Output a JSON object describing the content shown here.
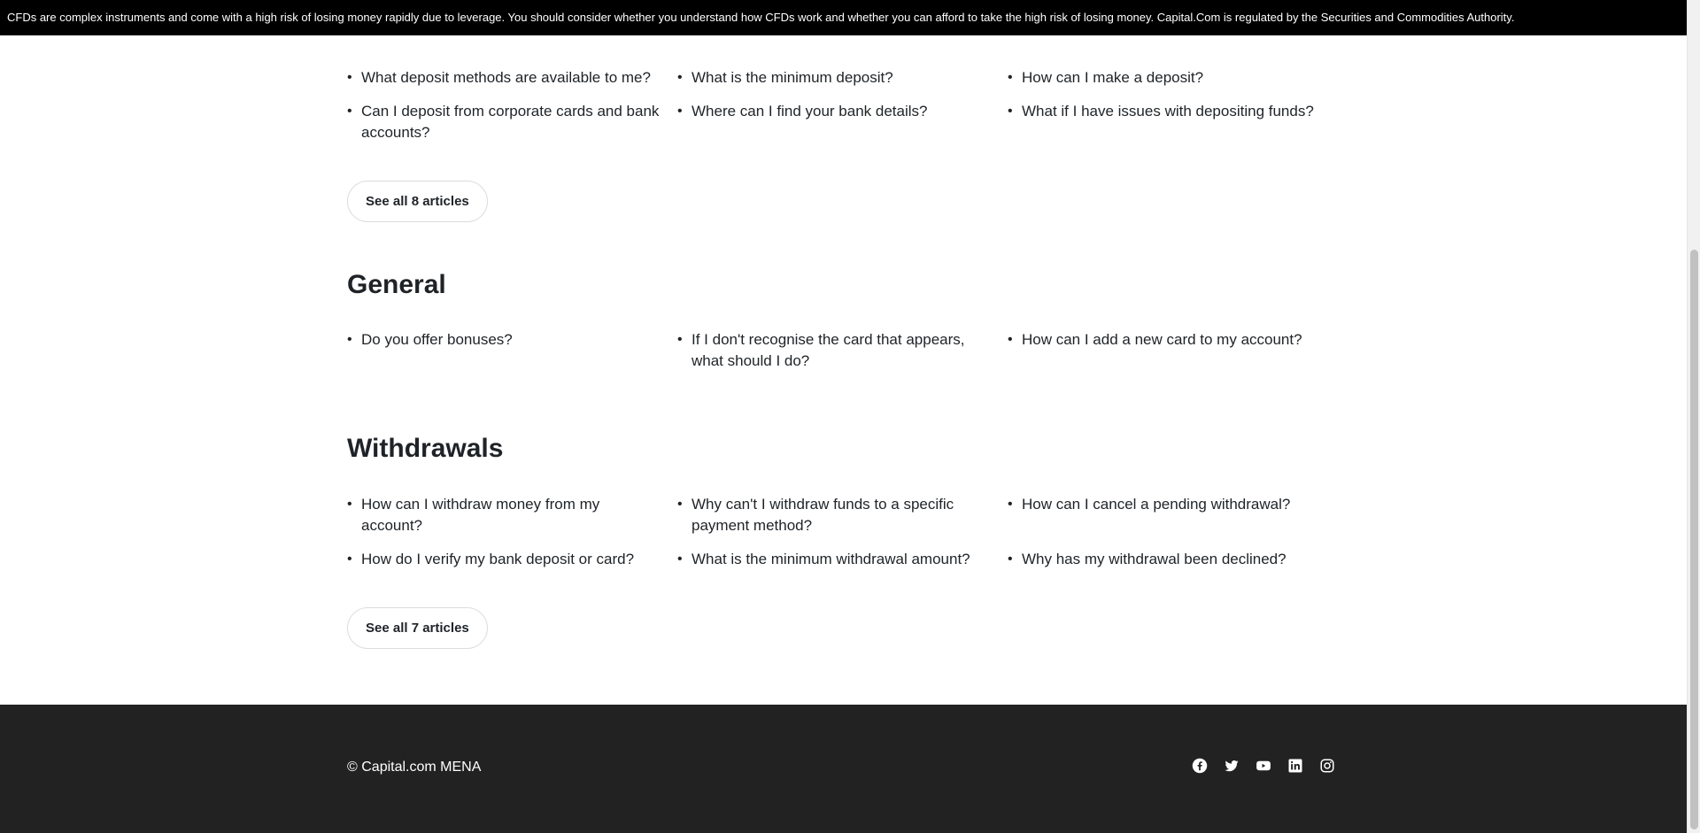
{
  "banner": {
    "text": "CFDs are complex instruments and come with a high risk of losing money rapidly due to leverage. You should consider whether you understand how CFDs work and whether you can afford to take the high risk of losing money. Capital.Com is regulated by the Securities and Commodities Authority."
  },
  "deposits": {
    "articles": [
      "What deposit methods are available to me?",
      "What is the minimum deposit?",
      "How can I make a deposit?",
      "Can I deposit from corporate cards and bank accounts?",
      "Where can I find your bank details?",
      "What if I have issues with depositing funds?"
    ],
    "see_all": "See all 8 articles"
  },
  "general": {
    "title": "General",
    "articles": [
      "Do you offer bonuses?",
      "If I don't recognise the card that appears, what should I do?",
      "How can I add a new card to my account?"
    ]
  },
  "withdrawals": {
    "title": "Withdrawals",
    "articles": [
      "How can I withdraw money from my account?",
      "Why can't I withdraw funds to a specific payment method?",
      "How can I cancel a pending withdrawal?",
      "How do I verify my bank deposit or card?",
      "What is the minimum withdrawal amount?",
      "Why has my withdrawal been declined?"
    ],
    "see_all": "See all 7 articles"
  },
  "footer": {
    "copyright": "© Capital.com MENA",
    "socials": [
      "facebook-icon",
      "twitter-icon",
      "youtube-icon",
      "linkedin-icon",
      "instagram-icon"
    ]
  }
}
